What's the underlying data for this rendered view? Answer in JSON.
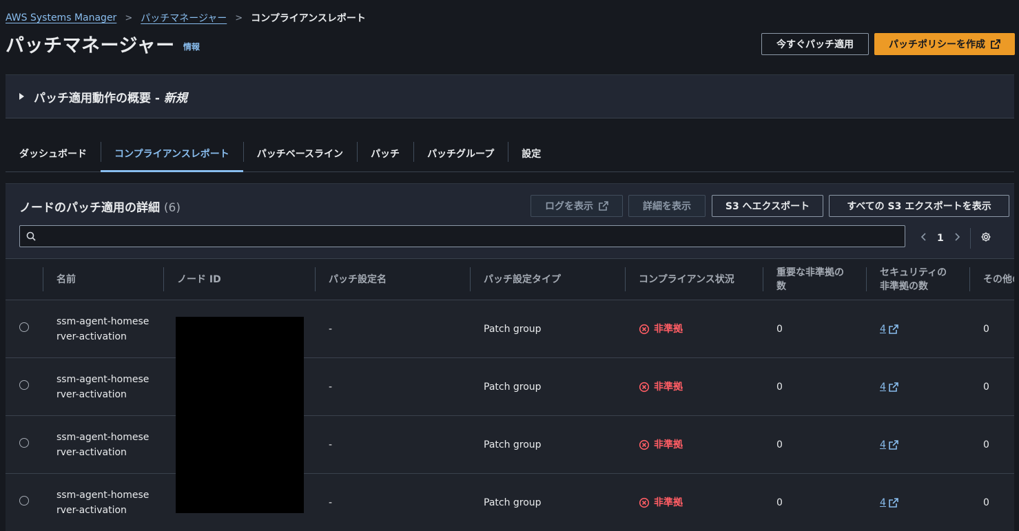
{
  "breadcrumb": {
    "root": "AWS Systems Manager",
    "parent": "パッチマネージャー",
    "current": "コンプライアンスレポート"
  },
  "page": {
    "title": "パッチマネージャー",
    "info": "情報"
  },
  "header_buttons": {
    "patch_now": "今すぐパッチ適用",
    "create_policy": "パッチポリシーを作成"
  },
  "overview": {
    "title": "パッチ適用動作の概要 - ",
    "title_new": "新規"
  },
  "tabs": [
    "ダッシュボード",
    "コンプライアンスレポート",
    "パッチベースライン",
    "パッチ",
    "パッチグループ",
    "設定"
  ],
  "table_section": {
    "title": "ノードのパッチ適用の詳細",
    "count": "(6)",
    "actions": {
      "view_logs": "ログを表示",
      "view_details": "詳細を表示",
      "export_s3": "S3 へエクスポート",
      "view_all_exports": "すべての S3 エクスポートを表示"
    },
    "search_placeholder": "",
    "page": "1"
  },
  "columns": [
    "名前",
    "ノード ID",
    "パッチ設定名",
    "パッチ設定タイプ",
    "コンプライアンス状況",
    "重要な非準拠の数",
    "セキュリティの非準拠の数",
    "その他の非準拠の数"
  ],
  "rows": [
    {
      "name": "ssm-agent-homeserver-activation",
      "config_name": "-",
      "config_type": "Patch group",
      "status": "非準拠",
      "critical": "0",
      "security": "4",
      "other": "0"
    },
    {
      "name": "ssm-agent-homeserver-activation",
      "config_name": "-",
      "config_type": "Patch group",
      "status": "非準拠",
      "critical": "0",
      "security": "4",
      "other": "0"
    },
    {
      "name": "ssm-agent-homeserver-activation",
      "config_name": "-",
      "config_type": "Patch group",
      "status": "非準拠",
      "critical": "0",
      "security": "4",
      "other": "0"
    },
    {
      "name": "ssm-agent-homeserver-activation",
      "config_name": "-",
      "config_type": "Patch group",
      "status": "非準拠",
      "critical": "0",
      "security": "4",
      "other": "0"
    }
  ],
  "colors": {
    "accent": "#89bdee",
    "primary": "#ec9a26",
    "error": "#ff5d64",
    "background": "#16191f"
  }
}
